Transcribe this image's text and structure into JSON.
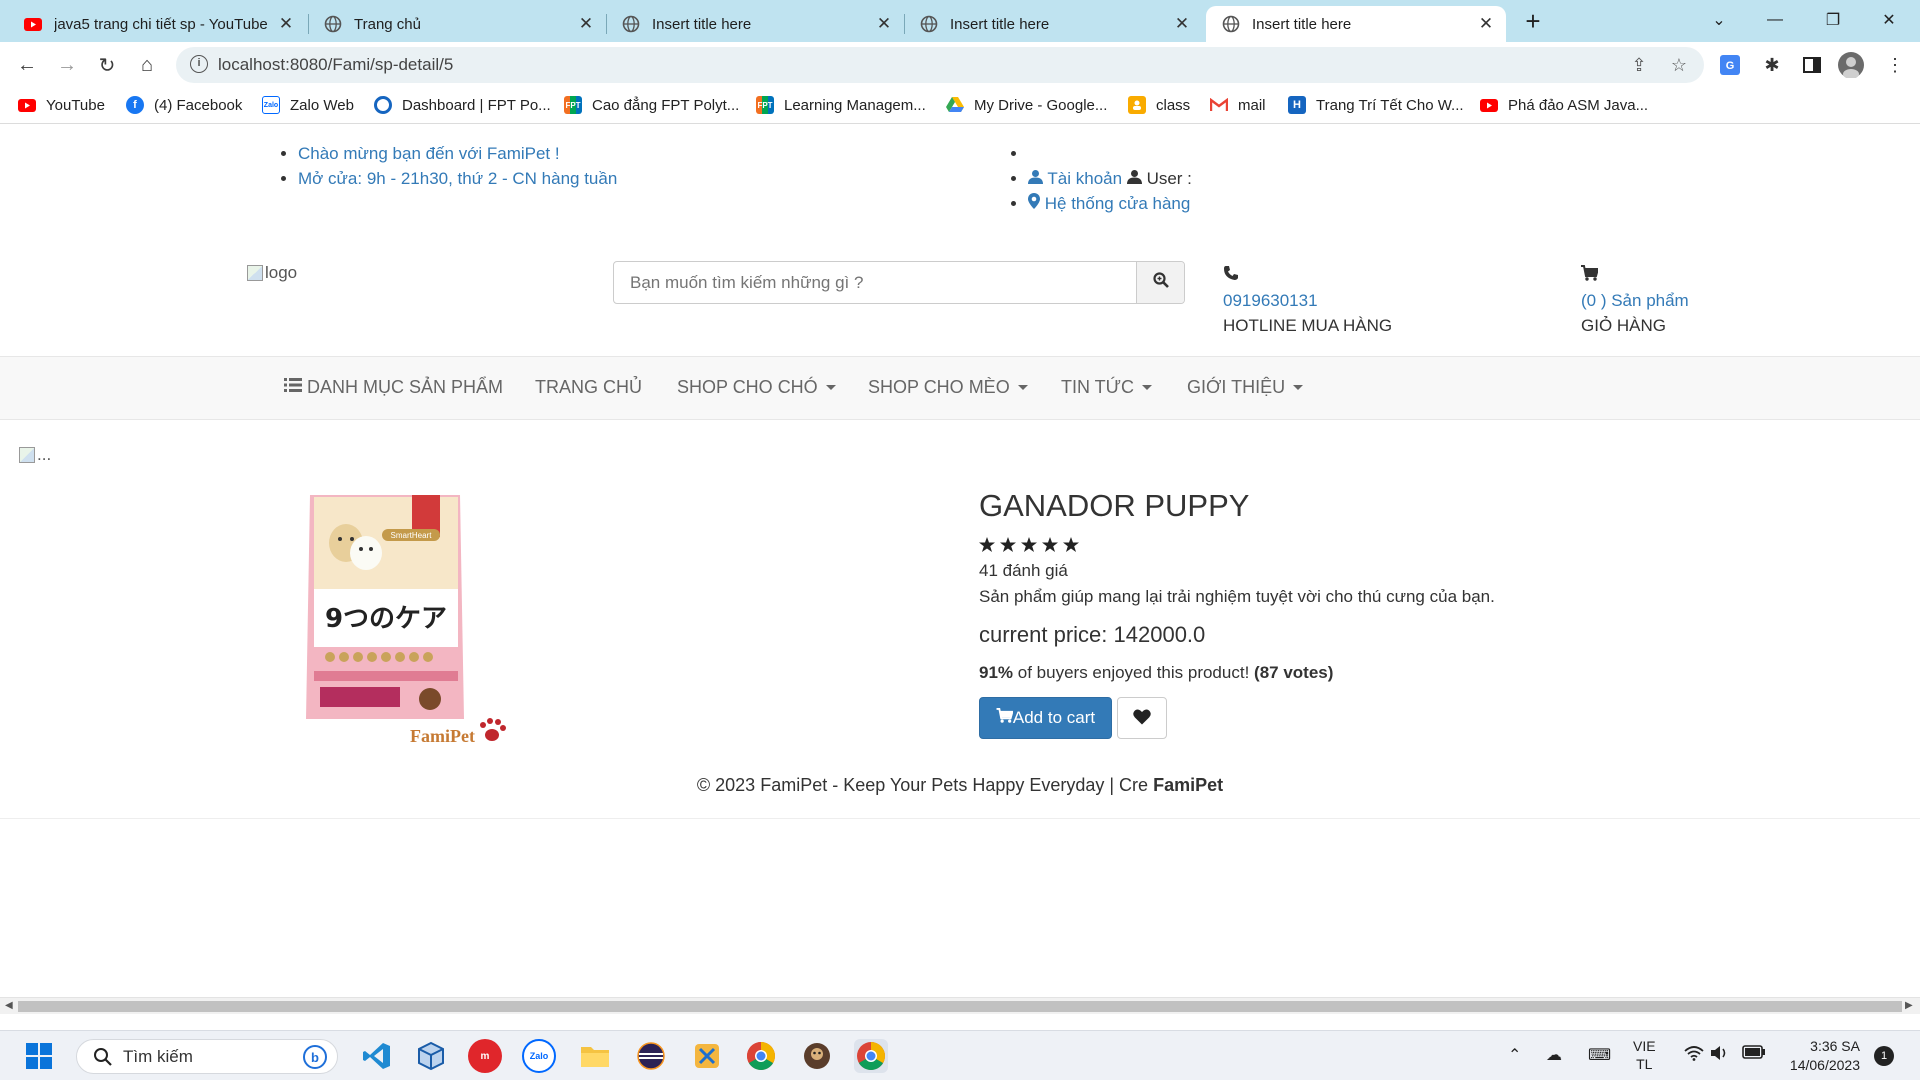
{
  "browser": {
    "tabs": [
      {
        "label": "java5 trang chi tiết sp - YouTube",
        "favicon": "youtube-icon",
        "active": false
      },
      {
        "label": "Trang chủ",
        "favicon": "globe-icon",
        "active": false
      },
      {
        "label": "Insert title here",
        "favicon": "globe-icon",
        "active": false
      },
      {
        "label": "Insert title here",
        "favicon": "globe-icon",
        "active": false
      },
      {
        "label": "Insert title here",
        "favicon": "globe-icon",
        "active": true
      }
    ],
    "url": "localhost:8080/Fami/sp-detail/5",
    "bookmarks": [
      {
        "label": "YouTube",
        "icon": "youtube-icon"
      },
      {
        "label": "(4) Facebook",
        "icon": "facebook-icon"
      },
      {
        "label": "Zalo Web",
        "icon": "zalo-icon"
      },
      {
        "label": "Dashboard | FPT Po...",
        "icon": "ring-icon"
      },
      {
        "label": "Cao đẳng FPT Polyt...",
        "icon": "fpt-icon"
      },
      {
        "label": "Learning Managem...",
        "icon": "fpt-icon"
      },
      {
        "label": "My Drive - Google...",
        "icon": "drive-icon"
      },
      {
        "label": "class",
        "icon": "classroom-icon"
      },
      {
        "label": "mail",
        "icon": "gmail-icon"
      },
      {
        "label": "Trang Trí Tết Cho W...",
        "icon": "h-icon"
      },
      {
        "label": "Phá đảo ASM Java...",
        "icon": "youtube-icon"
      }
    ]
  },
  "site": {
    "welcome": "Chào mừng bạn đến với FamiPet !",
    "hours": "Mở cửa: 9h - 21h30, thứ 2 - CN hàng tuần",
    "account_link": "Tài khoản",
    "user_label": "User :",
    "stores_link": "Hệ thống cửa hàng",
    "logo_alt": "logo",
    "search_placeholder": "Bạn muốn tìm kiếm những gì ?",
    "phone": "0919630131",
    "hotline_label": "HOTLINE MUA HÀNG",
    "cart_link": "(0 ) Sản phẩm",
    "cart_label": "GIỎ HÀNG",
    "menu": {
      "categories": "DANH MỤC SẢN PHẨM",
      "home": "TRANG CHỦ",
      "dog_shop": "SHOP CHO CHÓ",
      "cat_shop": "SHOP CHO MÈO",
      "news": "TIN TỨC",
      "about": "GIỚI THIỆU"
    },
    "banner_alt": "..."
  },
  "product": {
    "name": "GANADOR PUPPY",
    "stars": 5,
    "reviews": "41 đánh giá",
    "description": "Sản phẩm giúp mang lại trải nghiệm tuyệt vời cho thú cưng của bạn.",
    "price_label": "current price:",
    "price": "142000.0",
    "percent": "91%",
    "buyers_text": "of buyers enjoyed this product!",
    "votes": "(87 votes)",
    "add_to_cart": "Add to cart",
    "package_text": "9つのケア",
    "package_brand": "SmartHeart",
    "watermark": "FamiPet"
  },
  "footer": {
    "text": "© 2023 FamiPet - Keep Your Pets Happy Everyday | Cre",
    "brand": "FamiPet"
  },
  "taskbar": {
    "search_placeholder": "Tìm kiếm",
    "lang_top": "VIE",
    "lang_bottom": "TL",
    "time": "3:36 SA",
    "date": "14/06/2023",
    "notifications": "1"
  }
}
